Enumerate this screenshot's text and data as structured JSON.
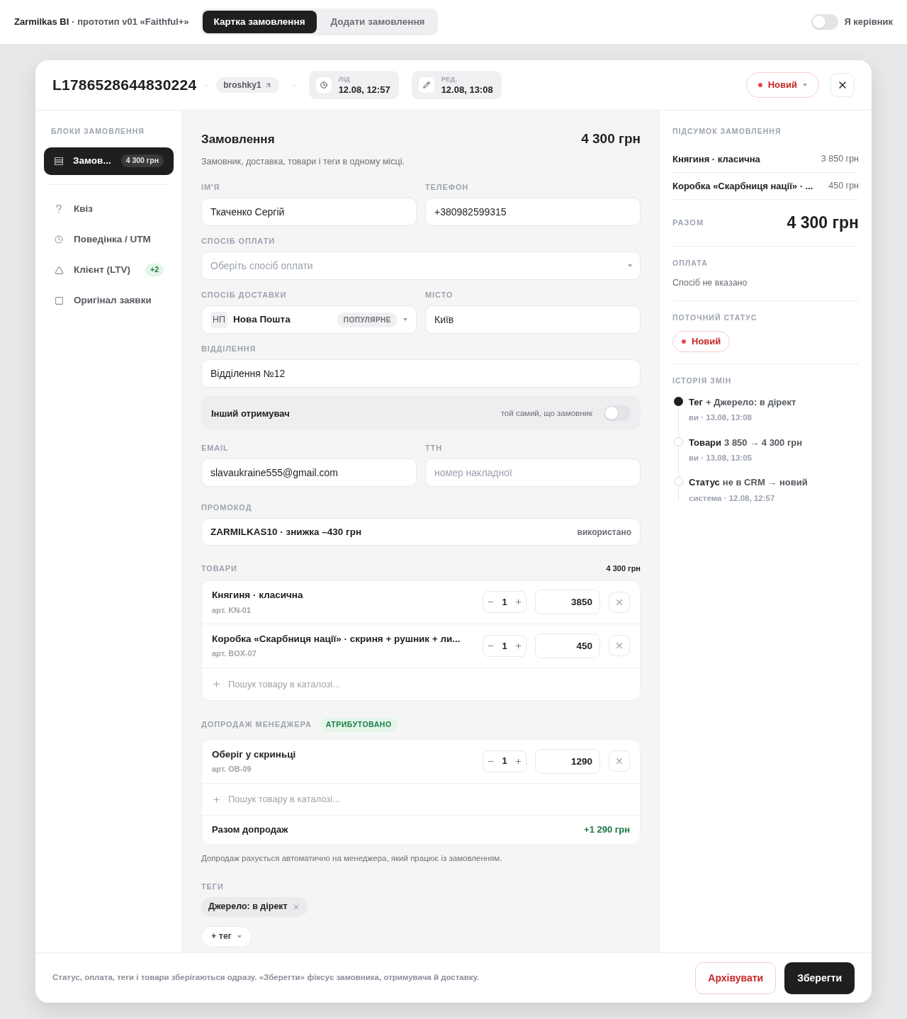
{
  "topbar": {
    "brand": "Zarmilkas BI",
    "subtitle": "· прототип v01 «Faithful+»",
    "tabs": [
      {
        "label": "Картка замовлення",
        "selected": true
      },
      {
        "label": "Додати замовлення",
        "selected": false
      }
    ],
    "toggle": {
      "label": "Я керівник",
      "on": false
    }
  },
  "header": {
    "order_id": "L1786528644830224",
    "separators": [
      "·",
      "·"
    ],
    "source": "broshky1",
    "dates": [
      {
        "label": "ЛІД",
        "value": "12.08, 12:57"
      },
      {
        "label": "РЕД.",
        "value": "12.08, 13:08"
      }
    ],
    "status": {
      "label": "Новий",
      "color": "#e5484d"
    }
  },
  "sidebar": {
    "title": "БЛОКИ ЗАМОВЛЕННЯ",
    "items": [
      {
        "label": "Замов...",
        "badge": "4 300 грн",
        "selected": true
      },
      {
        "label": "Квіз",
        "selected": false
      },
      {
        "label": "Поведінка / UTM",
        "selected": false
      },
      {
        "label": "Клієнт (LTV)",
        "badge": "+2",
        "selected": false
      },
      {
        "label": "Оригінал заявки",
        "selected": false
      }
    ]
  },
  "main": {
    "title": "Замовлення",
    "total": "4 300 грн",
    "subtitle": "Замовник, доставка, товари і теги в одному місці.",
    "name": {
      "label": "ІМ'Я",
      "value": "Ткаченко Сергій"
    },
    "phone": {
      "label": "ТЕЛЕФОН",
      "value": "+380982599315"
    },
    "payment": {
      "label": "СПОСІБ ОПЛАТИ",
      "placeholder": "Оберіть спосіб оплати"
    },
    "delivery": {
      "label": "СПОСІБ ДОСТАВКИ",
      "badge": "НП",
      "value": "Нова Пошта",
      "tag": "ПОПУЛЯРНЕ"
    },
    "city": {
      "label": "МІСТО",
      "value": "Київ"
    },
    "branch": {
      "label": "ВІДДІЛЕННЯ",
      "value": "Відділення №12"
    },
    "recipient": {
      "label": "Інший отримувач",
      "hint": "той самий, що замовник",
      "on": false
    },
    "email": {
      "label": "EMAIL",
      "value": "slavaukraine555@gmail.com"
    },
    "ttn": {
      "label": "ТТН",
      "placeholder": "номер накладної"
    },
    "promo": {
      "label": "ПРОМОКОД",
      "value": "ZARMILKAS10 · знижка –430 грн",
      "status": "використано"
    },
    "products": {
      "label": "ТОВАРИ",
      "total": "4 300 грн",
      "items": [
        {
          "name": "Княгиня · класична",
          "sku": "арт. KN-01",
          "qty": "1",
          "price": "3850"
        },
        {
          "name": "Коробка «Скарбниця нації» · скриня + рушник + ли...",
          "sku": "арт. BOX-07",
          "qty": "1",
          "price": "450"
        }
      ],
      "search_placeholder": "Пошук товару в каталозі..."
    },
    "upsell": {
      "label": "ДОПРОДАЖ МЕНЕДЖЕРА",
      "badge": "АТРИБУТОВАНО",
      "items": [
        {
          "name": "Оберіг у скриньці",
          "sku": "арт. OB-09",
          "qty": "1",
          "price": "1290"
        }
      ],
      "search_placeholder": "Пошук товару в каталозі...",
      "total_label": "Разом допродаж",
      "total": "+1 290 грн",
      "note": "Допродаж рахується автоматично на менеджера, який працює із замовленням."
    },
    "tags": {
      "label": "ТЕГИ",
      "items": [
        {
          "label": "Джерело: в дірект"
        }
      ],
      "add": "+ тег"
    }
  },
  "summary": {
    "title": "ПІДСУМОК ЗАМОВЛЕННЯ",
    "lines": [
      {
        "name": "Княгиня · класична",
        "price": "3 850 грн"
      },
      {
        "name": "Коробка «Скарбниця нації» · ...",
        "price": "450 грн"
      }
    ],
    "total_label": "РАЗОМ",
    "total": "4 300 грн",
    "payment_label": "ОПЛАТА",
    "payment_value": "Спосіб не вказано",
    "status_label": "ПОТОЧНИЙ СТАТУС",
    "status": {
      "label": "Новий",
      "color": "#e5484d"
    },
    "history_label": "ІСТОРІЯ ЗМІН",
    "history": [
      {
        "title": "Тег",
        "detail": "+ Джерело: в дірект",
        "meta": "ви · 13.08, 13:08",
        "active": true
      },
      {
        "title": "Товари",
        "detail": "3 850 → 4 300 грн",
        "meta": "ви · 13.08, 13:05",
        "active": false
      },
      {
        "title": "Статус",
        "detail": "не в CRM → новий",
        "meta": "система · 12.08, 12:57",
        "active": false
      }
    ]
  },
  "footer": {
    "note": "Статус, оплата, теги і товари зберігаються одразу. «Зберегти» фіксує замовника, отримувача й доставку.",
    "archive": "Архівувати",
    "save": "Зберегти"
  }
}
